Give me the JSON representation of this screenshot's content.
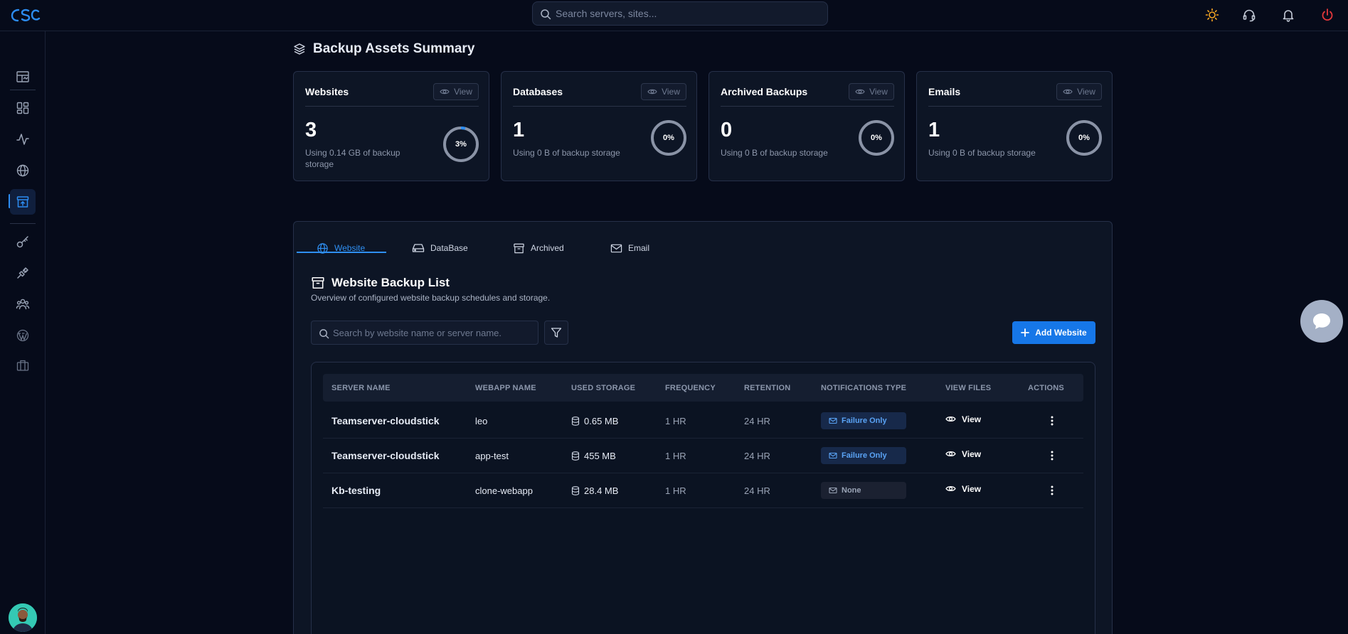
{
  "header": {
    "logo_text": "cSc",
    "search_placeholder": "Search servers, sites...",
    "icons": [
      "sun-icon",
      "headset-icon",
      "bell-icon",
      "power-icon"
    ]
  },
  "sidebar": {
    "items": [
      "dashboard-icon",
      "grid-icon",
      "activity-icon",
      "globe-icon",
      "backup-icon",
      "key-icon",
      "plug-icon",
      "team-icon",
      "wordpress-icon",
      "briefcase-icon"
    ],
    "active": "backup-icon"
  },
  "summary": {
    "title": "Backup Assets Summary",
    "cards": [
      {
        "title": "Websites",
        "view": "View",
        "value": "3",
        "sub": "Using 0.14 GB of backup storage",
        "percent": "3%",
        "fraction": 0.03
      },
      {
        "title": "Databases",
        "view": "View",
        "value": "1",
        "sub": "Using 0 B of backup storage",
        "percent": "0%",
        "fraction": 0
      },
      {
        "title": "Archived Backups",
        "view": "View",
        "value": "0",
        "sub": "Using 0 B of backup storage",
        "percent": "0%",
        "fraction": 0
      },
      {
        "title": "Emails",
        "view": "View",
        "value": "1",
        "sub": "Using 0 B of backup storage",
        "percent": "0%",
        "fraction": 0
      }
    ]
  },
  "tabs": [
    {
      "label": "Website",
      "active": true
    },
    {
      "label": "DataBase",
      "active": false
    },
    {
      "label": "Archived",
      "active": false
    },
    {
      "label": "Email",
      "active": false
    }
  ],
  "list": {
    "title": "Website Backup List",
    "subtitle": "Overview of configured website backup schedules and storage.",
    "search_placeholder": "Search by website name or server name.",
    "add_label": "Add Website",
    "columns": [
      "SERVER NAME",
      "WEBAPP NAME",
      "USED STORAGE",
      "FREQUENCY",
      "RETENTION",
      "NOTIFICATIONS TYPE",
      "VIEW FILES",
      "ACTIONS"
    ],
    "rows": [
      {
        "server": "Teamserver-cloudstick",
        "webapp": "leo",
        "storage": "0.65 MB",
        "frequency": "1 HR",
        "retention": "24 HR",
        "notification": "Failure Only",
        "view": "View"
      },
      {
        "server": "Teamserver-cloudstick",
        "webapp": "app-test",
        "storage": "455 MB",
        "frequency": "1 HR",
        "retention": "24 HR",
        "notification": "Failure Only",
        "view": "View"
      },
      {
        "server": "Kb-testing",
        "webapp": "clone-webapp",
        "storage": "28.4 MB",
        "frequency": "1 HR",
        "retention": "24 HR",
        "notification": "None",
        "view": "View"
      }
    ]
  },
  "colors": {
    "accent": "#1677e8",
    "background": "#060b1a",
    "card": "#0d1525",
    "badge_failure": "#5aa3f5"
  }
}
